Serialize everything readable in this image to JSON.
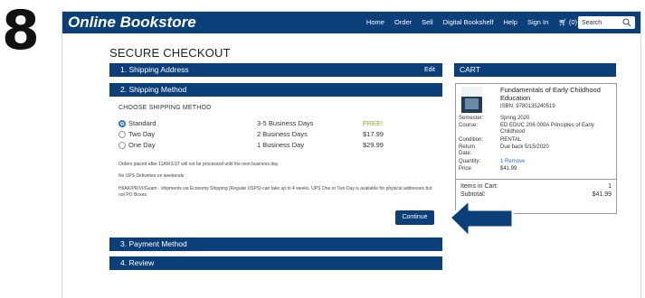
{
  "step_number": "8",
  "header": {
    "brand": "Online Bookstore",
    "nav": [
      "Home",
      "Order",
      "Sell",
      "Digital Bookshelf",
      "Help",
      "Sign In"
    ],
    "cart_label": "(0)",
    "search_placeholder": "Search"
  },
  "page_title": "SECURE CHECKOUT",
  "sections": {
    "shipping_address": {
      "label": "1. Shipping Address",
      "edit": "Edit"
    },
    "shipping_method": {
      "label": "2. Shipping Method"
    },
    "payment_method": {
      "label": "3. Payment Method"
    },
    "review": {
      "label": "4. Review"
    }
  },
  "shipping": {
    "heading": "CHOOSE SHIPPING METHOD",
    "options": [
      {
        "name": "Standard",
        "days": "3-5 Business Days",
        "price": "FREE!",
        "selected": true
      },
      {
        "name": "Two Day",
        "days": "2 Business Days",
        "price": "$17.99",
        "selected": false
      },
      {
        "name": "One Day",
        "days": "1 Business Day",
        "price": "$29.99",
        "selected": false
      }
    ],
    "notes": [
      "Orders placed after 11AM EST will not be processed until the next business day.",
      "No UPS Deliveries on weekends",
      "HI/AK/PR/VI/Guam - shipments via Economy Shipping (Regular USPS) can take up to 4 weeks. UPS One or Two Day is available for physical addresses but not PO Boxes."
    ],
    "continue_label": "Continue"
  },
  "cart": {
    "title": "CART",
    "item": {
      "title": "Fundamentals of Early Childhood Education",
      "isbn": "ISBN: 9780135240519",
      "details": [
        {
          "label": "Semester:",
          "value": "Spring 2020"
        },
        {
          "label": "Course:",
          "value": "ED EDUC 206 000A Principles of Early Childhood"
        },
        {
          "label": "Condition:",
          "value": "RENTAL"
        },
        {
          "label": "Return Date:",
          "value": "Due back 5/15/2020"
        },
        {
          "label": "Quantity:",
          "value": "1 Remove"
        },
        {
          "label": "Price:",
          "value": "$41.99"
        }
      ]
    },
    "items_in_cart_label": "Items in Cart:",
    "items_in_cart_value": "1",
    "subtotal_label": "Subtotal:",
    "subtotal_value": "$41.99"
  },
  "colors": {
    "primary": "#0b3f7a",
    "free": "#7fb51a",
    "link": "#2b6fd6"
  }
}
